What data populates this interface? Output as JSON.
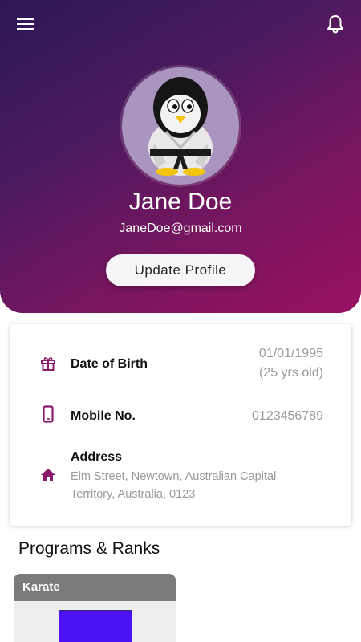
{
  "header": {
    "menu_icon": "hamburger-menu-icon",
    "notification_icon": "bell-icon",
    "gradient_start": "#2c1855",
    "gradient_end": "#9a1262"
  },
  "profile": {
    "name": "Jane Doe",
    "email": "JaneDoe@gmail.com",
    "update_button_label": "Update Profile",
    "avatar_icon": "penguin-avatar"
  },
  "details": {
    "accent_color": "#8a1a6b",
    "date_of_birth": {
      "icon": "gift-icon",
      "label": "Date of Birth",
      "value": "01/01/1995",
      "age": "(25 yrs old)"
    },
    "mobile": {
      "icon": "phone-icon",
      "label": "Mobile No.",
      "value": "0123456789"
    },
    "address": {
      "icon": "home-icon",
      "label": "Address",
      "line1": "Elm Street, Newtown, Australian Capital",
      "line2": "Territory, Australia, 0123"
    }
  },
  "programs": {
    "title": "Programs & Ranks",
    "items": [
      {
        "name": "Karate",
        "rank_color": "#4a12f5"
      }
    ]
  }
}
